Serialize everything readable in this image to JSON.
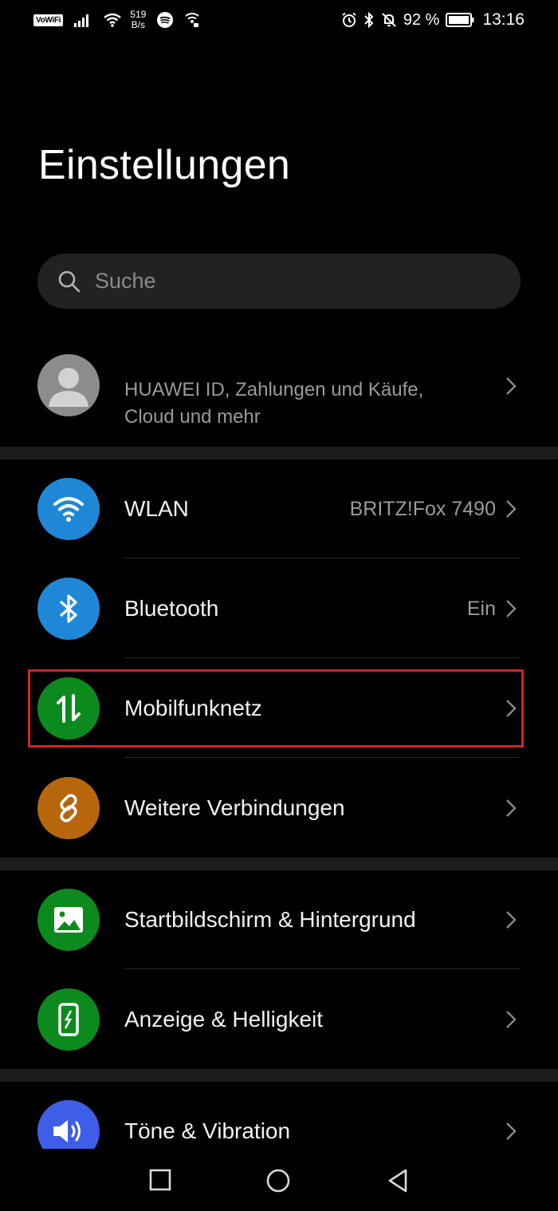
{
  "status_bar": {
    "vowifi": "VoWiFi",
    "net_speed_value": "519",
    "net_speed_unit": "B/s",
    "battery": "92 %",
    "time": "13:16",
    "icons": [
      "signal-icon",
      "wifi-icon",
      "spotify-icon",
      "hotspot-icon",
      "alarm-icon",
      "bluetooth-icon",
      "mute-icon",
      "battery-icon"
    ]
  },
  "header": {
    "title": "Einstellungen"
  },
  "search": {
    "placeholder": "Suche"
  },
  "account": {
    "line1": "HUAWEI ID, Zahlungen und Käufe,",
    "line2": "Cloud und mehr"
  },
  "settings": [
    {
      "label": "WLAN",
      "value": "BRITZ!Fox 7490",
      "icon": "wifi-icon",
      "color": "#1f88d6"
    },
    {
      "label": "Bluetooth",
      "value": "Ein",
      "icon": "bluetooth-icon",
      "color": "#1f88d6"
    },
    {
      "label": "Mobilfunknetz",
      "value": "",
      "icon": "mobile-data-icon",
      "color": "#0c8a1e",
      "highlighted": true
    },
    {
      "label": "Weitere Verbindungen",
      "value": "",
      "icon": "link-icon",
      "color": "#b8660e"
    },
    {
      "label": "Startbildschirm & Hintergrund",
      "value": "",
      "icon": "image-icon",
      "color": "#0c8a1e"
    },
    {
      "label": "Anzeige & Helligkeit",
      "value": "",
      "icon": "phone-brightness-icon",
      "color": "#0c8a1e"
    },
    {
      "label": "Töne & Vibration",
      "value": "",
      "icon": "speaker-icon",
      "color": "#3e5ee8"
    }
  ],
  "highlight_color": "#d6202a",
  "nav_bar": {
    "buttons": [
      "recents-icon",
      "home-icon",
      "back-icon"
    ]
  }
}
